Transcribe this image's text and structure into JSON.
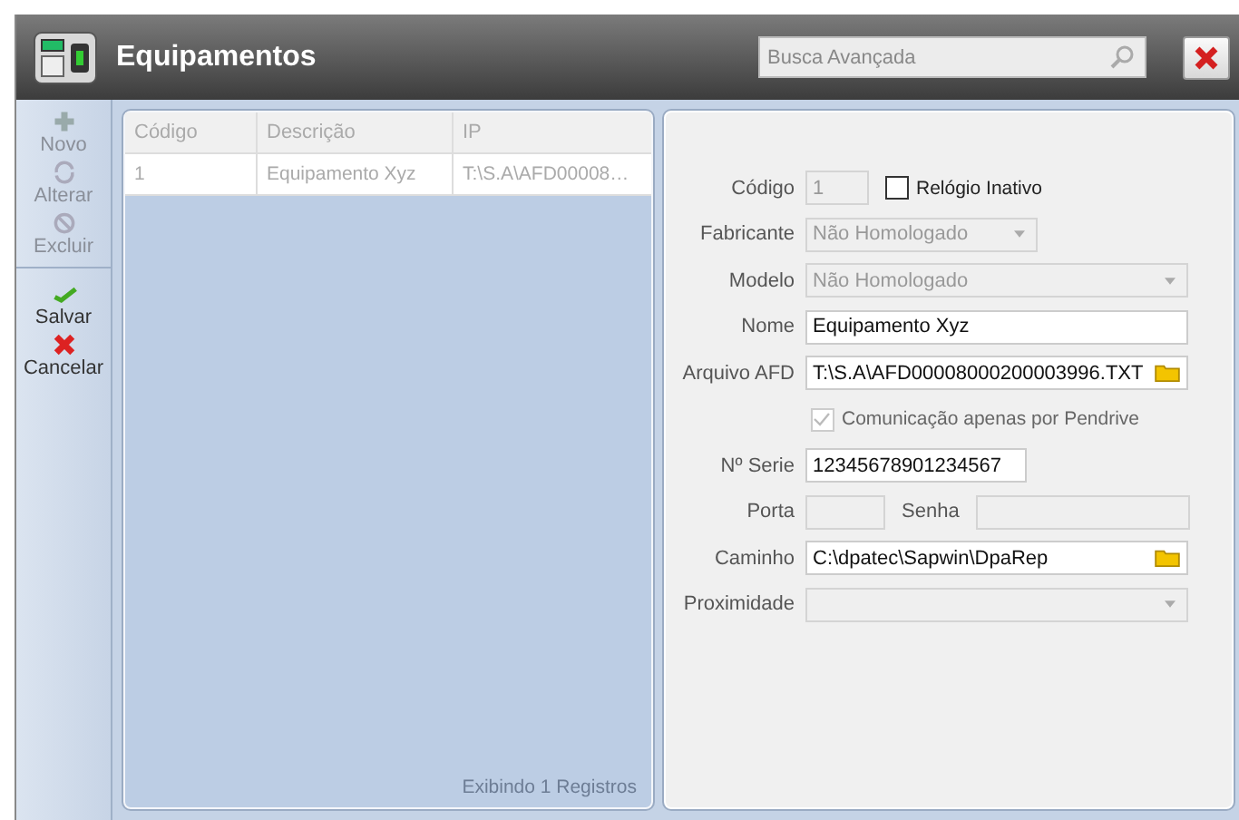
{
  "window": {
    "title": "Equipamentos"
  },
  "search": {
    "placeholder": "Busca Avançada"
  },
  "toolbar": [
    {
      "label": "Novo",
      "kind": "add",
      "disabled": true
    },
    {
      "label": "Alterar",
      "kind": "edit",
      "disabled": true
    },
    {
      "label": "Excluir",
      "kind": "delete",
      "disabled": true
    },
    {
      "label": "Salvar",
      "kind": "save",
      "disabled": false
    },
    {
      "label": "Cancelar",
      "kind": "cancel",
      "disabled": false
    }
  ],
  "table": {
    "columns": [
      "Código",
      "Descrição",
      "IP"
    ],
    "rows": [
      {
        "cells": [
          "1",
          "Equipamento Xyz",
          "T:\\S.A\\AFD00008…"
        ],
        "selected": false
      }
    ],
    "footer": "Exibindo 1 Registros"
  },
  "form": {
    "rows": [
      {
        "kind": "code",
        "label": "Código",
        "value": "1",
        "disabled": true,
        "check": {
          "label": "Relógio Inativo",
          "checked": false
        }
      },
      {
        "kind": "select",
        "label": "Fabricante",
        "value": "Não Homologado",
        "disabled": true,
        "wide": false
      },
      {
        "kind": "select",
        "label": "Modelo",
        "value": "Não Homologado",
        "disabled": true,
        "wide": true
      },
      {
        "kind": "text",
        "label": "Nome",
        "value": "Equipamento Xyz",
        "disabled": false
      },
      {
        "kind": "file",
        "label": "Arquivo AFD",
        "value": "T:\\S.A\\AFD00008000200003996.TXT",
        "disabled": false
      },
      {
        "kind": "check",
        "label": "Comunicação apenas por Pendrive",
        "checked": true,
        "disabled": true
      },
      {
        "kind": "short",
        "label": "Nº Serie",
        "value": "12345678901234567",
        "disabled": false
      },
      {
        "kind": "pair",
        "label": "Porta",
        "disabled": true,
        "label2": "Senha"
      },
      {
        "kind": "file",
        "label": "Caminho",
        "value": "C:\\dpatec\\Sapwin\\DpaRep",
        "disabled": false
      },
      {
        "kind": "select",
        "label": "Proximidade",
        "disabled": true,
        "wide": true
      }
    ]
  }
}
